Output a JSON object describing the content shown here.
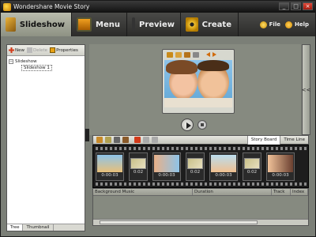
{
  "window": {
    "title": "Wondershare Movie Story"
  },
  "tabs": [
    {
      "label": "Slideshow",
      "icon": "slideshow-icon"
    },
    {
      "label": "Menu",
      "icon": "menu-icon"
    },
    {
      "label": "Preview",
      "icon": "preview-icon"
    },
    {
      "label": "Create",
      "icon": "create-icon"
    }
  ],
  "toolbar_right": {
    "file_label": "File",
    "help_label": "Help"
  },
  "left_panel": {
    "new_label": "New",
    "delete_label": "Delete",
    "properties_label": "Properties",
    "tree_root": "Slideshow",
    "tree_child": "Slideshow 1",
    "tab_tree": "Tree",
    "tab_thumbnail": "Thumbnail"
  },
  "storyboard": {
    "tab_storyboard": "Story Board",
    "tab_timeline": "Time Line",
    "clips": [
      {
        "type": "photo",
        "duration": "0:00:03"
      },
      {
        "type": "transition",
        "duration": "0:02"
      },
      {
        "type": "photo",
        "duration": "0:00:03"
      },
      {
        "type": "transition",
        "duration": "0:02"
      },
      {
        "type": "photo",
        "duration": "0:00:03"
      },
      {
        "type": "transition",
        "duration": "0:02"
      },
      {
        "type": "photo",
        "duration": "0:00:03"
      }
    ]
  },
  "tracks": {
    "col_music": "Background Music",
    "col_duration": "Duration",
    "col_track": "Track",
    "col_index": "Index"
  },
  "collapse_label": "<<"
}
